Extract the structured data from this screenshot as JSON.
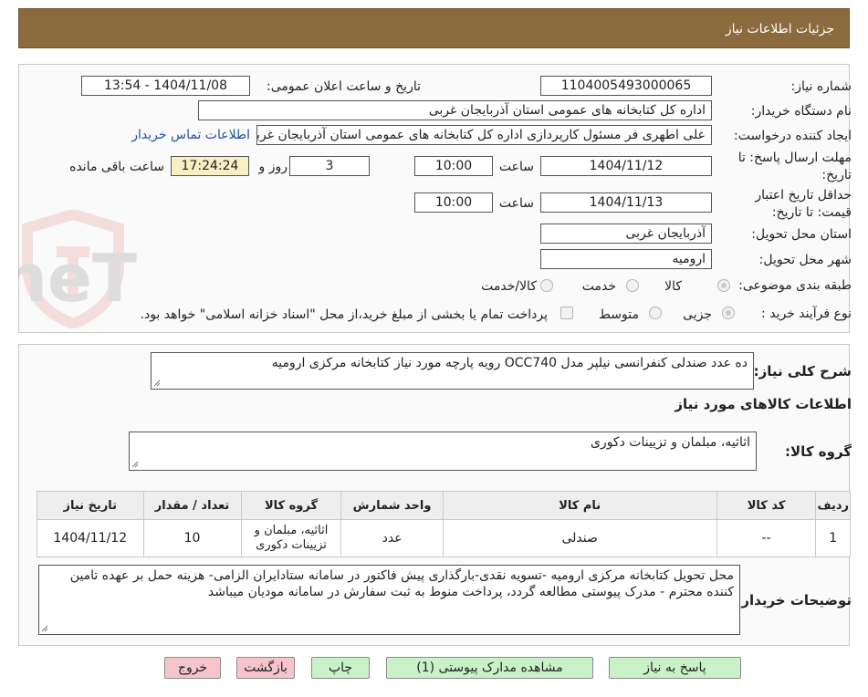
{
  "header": {
    "title": "جزئیات اطلاعات نیاز"
  },
  "watermark": {
    "text": "AriaTender.neT"
  },
  "form": {
    "need_number": {
      "label": "شماره نیاز:",
      "value": "1104005493000065"
    },
    "announce": {
      "label": "تاریخ و ساعت اعلان عمومی:",
      "value": "1404/11/08 - 13:54"
    },
    "buyer": {
      "label": "نام دستگاه خریدار:",
      "value": "اداره کل کتابخانه های عمومی استان آذربایجان غربی"
    },
    "creator": {
      "label": "ایجاد کننده درخواست:",
      "value": "علی اطهری فر مسئول کارپردازی اداره کل کتابخانه های عمومی استان آذربایجان غربی",
      "contact_link": "اطلاعات تماس خریدار"
    },
    "deadline": {
      "label_line1": "مهلت ارسال پاسخ: تا",
      "label_line2": "تاریخ:",
      "date": "1404/11/12",
      "time_label": "ساعت",
      "time": "10:00",
      "days": "3",
      "days_label": "روز و",
      "remaining": "17:24:24",
      "remaining_label": "ساعت باقی مانده"
    },
    "validity": {
      "label_line1": "حداقل تاریخ اعتبار",
      "label_line2": "قیمت: تا تاریخ:",
      "date": "1404/11/13",
      "time_label": "ساعت",
      "time": "10:00"
    },
    "province": {
      "label": "استان محل تحویل:",
      "value": "آذربایجان غربی"
    },
    "city": {
      "label": "شهر محل تحویل:",
      "value": "ارومیه"
    },
    "category": {
      "label": "طبقه بندی موضوعی:",
      "options": [
        "کالا",
        "خدمت",
        "کالا/خدمت"
      ]
    },
    "process": {
      "label": "نوع فرآیند خرید :",
      "options": [
        "جزیی",
        "متوسط"
      ],
      "note": "پرداخت تمام یا بخشی از مبلغ خرید،از محل \"اسناد خزانه اسلامی\" خواهد بود."
    }
  },
  "summary": {
    "label": "شرح کلی نیاز:",
    "value": "ده عدد صندلی کنفرانسی نیلپر مدل OCC740  رویه پارچه مورد نیاز کتابخانه مرکزی ارومیه",
    "items_title": "اطلاعات کالاهای مورد نیاز",
    "group_label": "گروه کالا:",
    "group_value": "اثاثیه، مبلمان و تزیینات دکوری"
  },
  "table": {
    "headers": [
      "ردیف",
      "کد کالا",
      "نام کالا",
      "واحد شمارش",
      "گروه کالا",
      "تعداد / مقدار",
      "تاریخ نیاز"
    ],
    "rows": [
      [
        "1",
        "--",
        "صندلی",
        "عدد",
        "اثاثیه، مبلمان و تزیینات دکوری",
        "10",
        "1404/11/12"
      ]
    ]
  },
  "buyer_notes": {
    "label": "توضیحات خریدار:",
    "value": "محل تحویل کتابخانه مرکزی ارومیه -تسویه نقدی-بارگذاری پیش فاکتور در سامانه ستادایران الزامی- هزینه حمل بر عهده تامین کننده محترم -  مدرک پیوستی مطالعه گردد، پرداخت منوط به ثبت سفارش در سامانه مودیان میباشد"
  },
  "buttons": {
    "reply": "پاسخ به نیاز",
    "attachments": "مشاهده مدارک پیوستی (1)",
    "print": "چاپ",
    "back": "بازگشت",
    "exit": "خروج"
  }
}
